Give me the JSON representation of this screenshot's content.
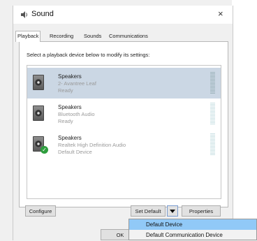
{
  "window": {
    "title": "Sound",
    "close_glyph": "×",
    "icon": "speaker-icon"
  },
  "tabs": [
    {
      "label": "Playback",
      "active": true
    },
    {
      "label": "Recording",
      "active": false
    },
    {
      "label": "Sounds",
      "active": false
    },
    {
      "label": "Communications",
      "active": false
    }
  ],
  "instruction": "Select a playback device below to modify its settings:",
  "devices": [
    {
      "name": "Speakers",
      "description": "2- Avantree Leaf",
      "status": "Ready",
      "selected": true,
      "default": false
    },
    {
      "name": "Speakers",
      "description": "Bluetooth Audio",
      "status": "Ready",
      "selected": false,
      "default": false
    },
    {
      "name": "Speakers",
      "description": "Realtek High Definition Audio",
      "status": "Default Device",
      "selected": false,
      "default": true
    }
  ],
  "buttons": {
    "configure": "Configure",
    "set_default": "Set Default",
    "properties": "Properties",
    "ok": "OK"
  },
  "dropdown": {
    "items": [
      {
        "label": "Default Device",
        "highlighted": true
      },
      {
        "label": "Default Communication Device",
        "highlighted": false
      }
    ]
  },
  "colors": {
    "selection": "#cbd7e4",
    "menu_highlight": "#91c9f7",
    "default_check": "#2e9e3e"
  }
}
